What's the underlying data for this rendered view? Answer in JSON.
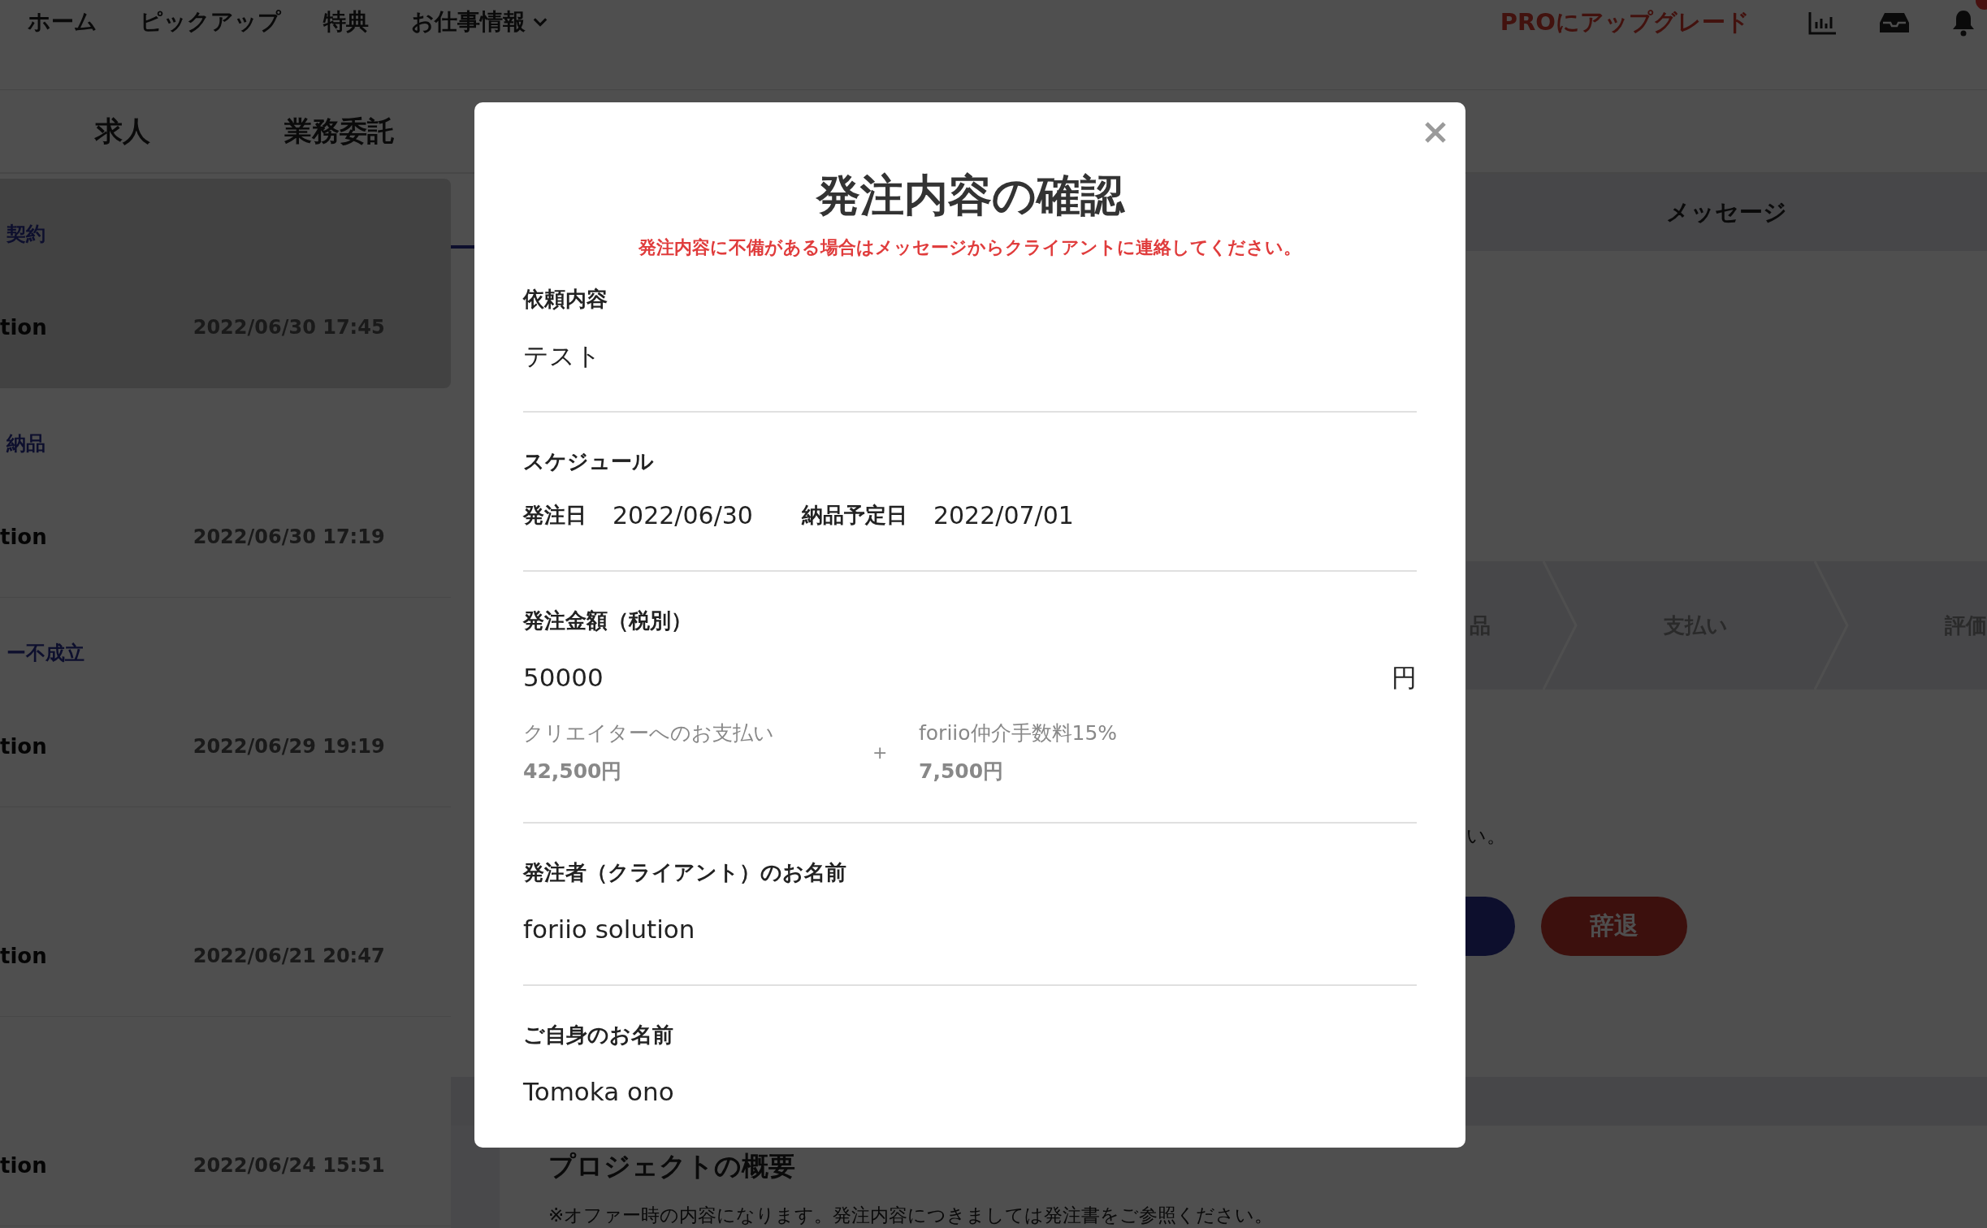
{
  "nav": {
    "items": [
      {
        "label": "ホーム",
        "dropdown": false
      },
      {
        "label": "ピックアップ",
        "dropdown": false
      },
      {
        "label": "特典",
        "dropdown": false
      },
      {
        "label": "お仕事情報",
        "dropdown": true
      }
    ],
    "upgrade": "PROにアップグレード"
  },
  "tabs": [
    {
      "label": "求人"
    },
    {
      "label": "業務委託"
    }
  ],
  "threads": [
    {
      "status": "契約",
      "name": "tion",
      "date": "2022/06/30 17:45",
      "selected": true
    },
    {
      "status": "納品",
      "name": "tion",
      "date": "2022/06/30 17:19",
      "selected": false
    },
    {
      "status": "ー不成立",
      "name": "tion",
      "date": "2022/06/29 19:19",
      "selected": false
    },
    {
      "name": "tion",
      "date": "2022/06/21 20:47",
      "selected": false
    },
    {
      "name": "tion",
      "date": "2022/06/24 15:51",
      "selected": false
    }
  ],
  "messages_header": "メッセージ",
  "steps": [
    "品",
    "支払い",
    "評価"
  ],
  "notice_tail": "い。",
  "decline_button": "辞退",
  "project": {
    "title": "プロジェクトの概要",
    "note": "※オファー時の内容になります。発注内容につきましては発注書をご参照ください。"
  },
  "modal": {
    "title": "発注内容の確認",
    "warning": "発注内容に不備がある場合はメッセージからクライアントに連絡してください。",
    "sections": [
      {
        "kind": "text",
        "label": "依頼内容",
        "value": "テスト"
      },
      {
        "kind": "schedule",
        "label": "スケジュール",
        "fields": [
          {
            "label": "発注日",
            "value": "2022/06/30"
          },
          {
            "label": "納品予定日",
            "value": "2022/07/01"
          }
        ]
      },
      {
        "kind": "amount",
        "label": "発注金額（税別）",
        "value": "50000",
        "unit": "円",
        "operator": "+",
        "breakdown": [
          {
            "label": "クリエイターへのお支払い",
            "value": "42,500円"
          },
          {
            "label": "foriio仲介手数料15%",
            "value": "7,500円"
          }
        ]
      },
      {
        "kind": "text",
        "label": "発注者（クライアント）のお名前",
        "value": "foriio solution"
      },
      {
        "kind": "text",
        "label": "ご自身のお名前",
        "value": "Tomoka ono"
      }
    ]
  }
}
